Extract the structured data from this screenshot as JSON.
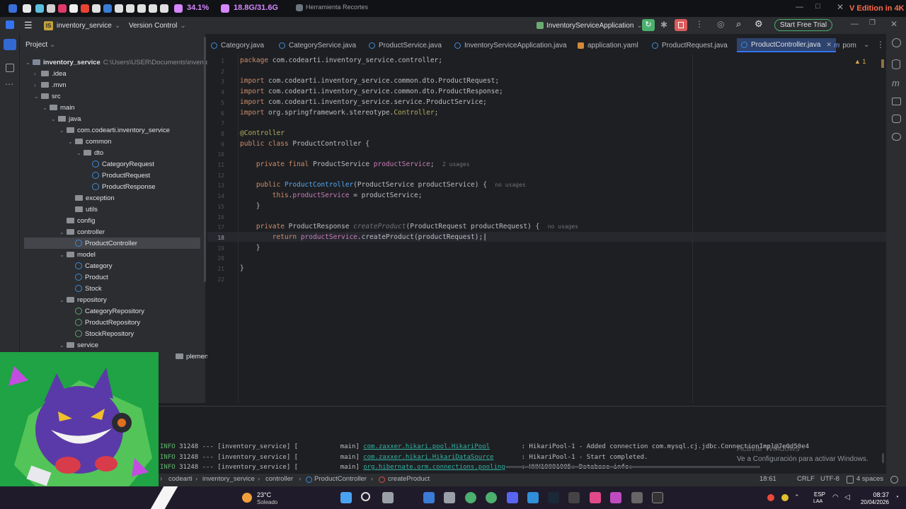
{
  "system": {
    "cpu": "34.1%",
    "ram": "18.8G/31.6G",
    "snip_title": "Herramienta Recortes",
    "edition": "V Edition in 4K"
  },
  "header": {
    "project": "inventory_service",
    "project_badge": "IS",
    "vcs": "Version Control",
    "run_config": "InventoryServiceApplication",
    "trial": "Start Free Trial"
  },
  "project_panel": {
    "title": "Project",
    "root": "inventory_service",
    "root_path": "C:\\Users\\USER\\Documents\\inventor",
    "items": [
      {
        "label": ".idea",
        "kind": "folder"
      },
      {
        "label": ".mvn",
        "kind": "folder"
      },
      {
        "label": "src",
        "kind": "folder"
      },
      {
        "label": "main",
        "kind": "folder"
      },
      {
        "label": "java",
        "kind": "folder"
      },
      {
        "label": "com.codearti.inventory_service",
        "kind": "package"
      },
      {
        "label": "common",
        "kind": "package"
      },
      {
        "label": "dto",
        "kind": "package"
      },
      {
        "label": "CategoryRequest",
        "kind": "class"
      },
      {
        "label": "ProductRequest",
        "kind": "class"
      },
      {
        "label": "ProductResponse",
        "kind": "class"
      },
      {
        "label": "exception",
        "kind": "package"
      },
      {
        "label": "utils",
        "kind": "package"
      },
      {
        "label": "config",
        "kind": "package"
      },
      {
        "label": "controller",
        "kind": "package"
      },
      {
        "label": "ProductController",
        "kind": "class"
      },
      {
        "label": "model",
        "kind": "package"
      },
      {
        "label": "Category",
        "kind": "class"
      },
      {
        "label": "Product",
        "kind": "class"
      },
      {
        "label": "Stock",
        "kind": "class"
      },
      {
        "label": "repository",
        "kind": "package"
      },
      {
        "label": "CategoryRepository",
        "kind": "interface"
      },
      {
        "label": "ProductRepository",
        "kind": "interface"
      },
      {
        "label": "StockRepository",
        "kind": "interface"
      },
      {
        "label": "service",
        "kind": "package"
      },
      {
        "label": "plementation",
        "kind": "package"
      }
    ]
  },
  "tabs": [
    {
      "label": "Category.java"
    },
    {
      "label": "CategoryService.java"
    },
    {
      "label": "ProductService.java"
    },
    {
      "label": "InventoryServiceApplication.java"
    },
    {
      "label": "application.yaml"
    },
    {
      "label": "ProductRequest.java"
    },
    {
      "label": "ProductController.java"
    },
    {
      "label": "pom"
    }
  ],
  "editor": {
    "warnings": "1",
    "lines": [
      {
        "n": "1",
        "parts": [
          [
            "kw",
            "package "
          ],
          [
            "",
            "com.codearti.inventory_service.controller;"
          ]
        ]
      },
      {
        "n": "2",
        "parts": []
      },
      {
        "n": "3",
        "parts": [
          [
            "kw",
            "import "
          ],
          [
            "",
            "com.codearti.inventory_service.common.dto.ProductRequest;"
          ]
        ]
      },
      {
        "n": "4",
        "parts": [
          [
            "kw",
            "import "
          ],
          [
            "",
            "com.codearti.inventory_service.common.dto.ProductResponse;"
          ]
        ]
      },
      {
        "n": "5",
        "parts": [
          [
            "kw",
            "import "
          ],
          [
            "",
            "com.codearti.inventory_service.service.ProductService;"
          ]
        ]
      },
      {
        "n": "6",
        "parts": [
          [
            "kw",
            "import "
          ],
          [
            "",
            "org.springframework.stereotype."
          ],
          [
            "an",
            "Controller"
          ],
          [
            "",
            ";"
          ]
        ]
      },
      {
        "n": "7",
        "parts": []
      },
      {
        "n": "8",
        "parts": [
          [
            "an",
            "@Controller"
          ]
        ]
      },
      {
        "n": "9",
        "parts": [
          [
            "kw",
            "public class "
          ],
          [
            "",
            "ProductController {"
          ]
        ]
      },
      {
        "n": "10",
        "parts": []
      },
      {
        "n": "11",
        "parts": [
          [
            "",
            "    "
          ],
          [
            "kw",
            "private final "
          ],
          [
            "",
            "ProductService "
          ],
          [
            "fld",
            "productService"
          ],
          [
            "",
            ";  "
          ],
          [
            "dim",
            "2 usages"
          ]
        ]
      },
      {
        "n": "12",
        "parts": []
      },
      {
        "n": "13",
        "parts": [
          [
            "",
            "    "
          ],
          [
            "kw",
            "public "
          ],
          [
            "fn",
            "ProductController"
          ],
          [
            "",
            "(ProductService productService) {  "
          ],
          [
            "dim",
            "no usages"
          ]
        ]
      },
      {
        "n": "14",
        "parts": [
          [
            "",
            "        "
          ],
          [
            "kw",
            "this"
          ],
          [
            "",
            "."
          ],
          [
            "fld",
            "productService"
          ],
          [
            "",
            " = productService;"
          ]
        ]
      },
      {
        "n": "15",
        "parts": [
          [
            "",
            "    }"
          ]
        ]
      },
      {
        "n": "16",
        "parts": []
      },
      {
        "n": "17",
        "parts": [
          [
            "",
            "    "
          ],
          [
            "kw",
            "private "
          ],
          [
            "",
            "ProductResponse "
          ],
          [
            "dimfn",
            "createProduct"
          ],
          [
            "",
            "(ProductRequest productRequest) {  "
          ],
          [
            "dim",
            "no usages"
          ]
        ]
      },
      {
        "n": "18",
        "parts": [
          [
            "",
            "        "
          ],
          [
            "kw",
            "return "
          ],
          [
            "fld",
            "productService"
          ],
          [
            "",
            ".createProduct(productRequest);"
          ]
        ]
      },
      {
        "n": "19",
        "parts": [
          [
            "",
            "    }"
          ]
        ]
      },
      {
        "n": "20",
        "parts": []
      },
      {
        "n": "21",
        "parts": [
          [
            "",
            "}"
          ]
        ]
      },
      {
        "n": "22",
        "parts": []
      }
    ]
  },
  "console": {
    "lines": [
      {
        "level": "INFO",
        "pid": "31248",
        "thread": "--- [inventory_service] [           main]",
        "source": "com.zaxxer.hikari.pool.HikariPool",
        "msg": ": HikariPool-1 - Added connection com.mysql.cj.jdbc.ConnectionImpl@7e0d50e4"
      },
      {
        "level": "INFO",
        "pid": "31248",
        "thread": "--- [inventory_service] [           main]",
        "source": "com.zaxxer.hikari.HikariDataSource",
        "msg": ": HikariPool-1 - Start completed."
      },
      {
        "level": "INFO",
        "pid": "31248",
        "thread": "--- [inventory_service] [           main]",
        "source": "org.hibernate.orm.connections.pooling",
        "msg": ": HHH10001005: Database info:"
      }
    ]
  },
  "watermark": {
    "line1": "Activar Windows",
    "line2": "Ve a Configuración para activar Windows."
  },
  "breadcrumbs": [
    "codearti",
    "inventory_service",
    "controller",
    "ProductController",
    "createProduct"
  ],
  "status": {
    "position": "18:61",
    "line_sep": "CRLF",
    "encoding": "UTF-8",
    "indent": "4 spaces"
  },
  "taskbar": {
    "temp": "23°C",
    "weather": "Soleado",
    "lang": "ESP",
    "lang2": "LAA",
    "time": "08:37",
    "date": "20/04/2026"
  }
}
